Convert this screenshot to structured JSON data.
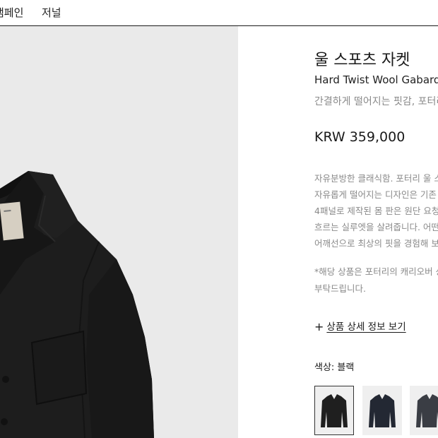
{
  "nav": {
    "campaign": "캠페인",
    "journal": "저널"
  },
  "product": {
    "title_ko": "울 스포츠 자켓",
    "title_en": "Hard Twist Wool Gabardine",
    "subtitle": "간결하게 떨어지는 핏감, 포터리",
    "price": "KRW 359,000",
    "description_lines": [
      "자유분방한 클래식함. 포터리 울 스",
      "자유롭게 떨어지는 디자인은 기존",
      "4패널로 제작된 몸 판은 원단 요청",
      "흐르는 실루엣을 살려줍니다. 어떤",
      "어깨선으로 최상의 핏을 경험해 보"
    ],
    "notice_lines": [
      "*해당 상품은 포터리의 캐리오버 상",
      "부탁드립니다."
    ],
    "details_link": "상품 상세 정보 보기",
    "color_label": "색상: 블랙"
  },
  "swatches": [
    {
      "name": "black",
      "color": "#1f1f1f"
    },
    {
      "name": "navy",
      "color": "#232833"
    },
    {
      "name": "charcoal",
      "color": "#3a3d44"
    }
  ],
  "icons": {
    "plus": "+"
  }
}
